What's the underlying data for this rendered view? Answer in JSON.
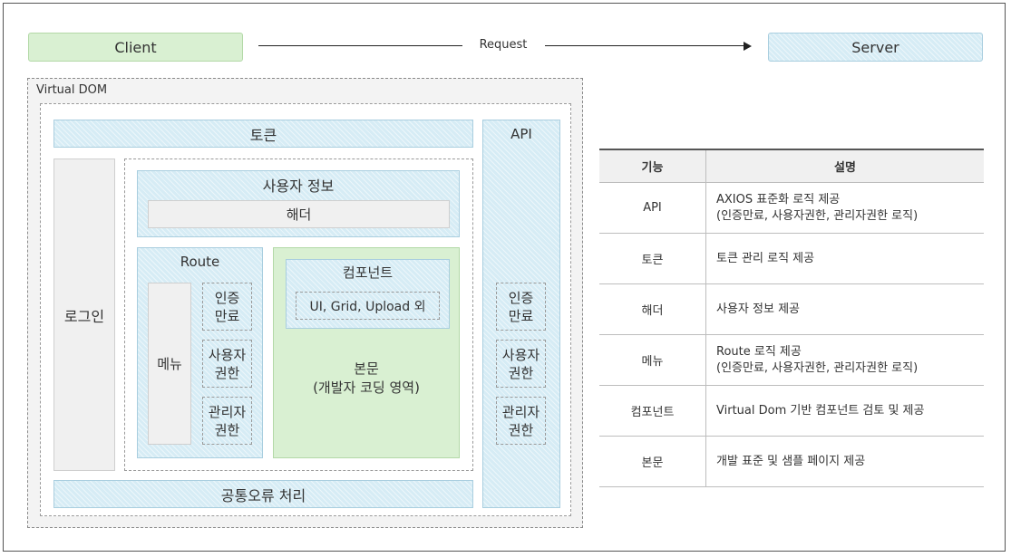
{
  "top": {
    "client": "Client",
    "request": "Request",
    "server": "Server"
  },
  "vdom": {
    "title": "Virtual DOM",
    "token": "토큰",
    "login": "로그인",
    "api": {
      "title": "API",
      "items": [
        {
          "line1": "인증",
          "line2": "만료"
        },
        {
          "line1": "사용자",
          "line2": "권한"
        },
        {
          "line1": "관리자",
          "line2": "권한"
        }
      ]
    },
    "user_info": "사용자 정보",
    "header": "해더",
    "route": {
      "title": "Route",
      "menu": "메뉴",
      "items": [
        {
          "line1": "인증",
          "line2": "만료"
        },
        {
          "line1": "사용자",
          "line2": "권한"
        },
        {
          "line1": "관리자",
          "line2": "권한"
        }
      ]
    },
    "body": {
      "component": "컴포넌트",
      "component_detail": "UI, Grid, Upload 외",
      "line1": "본문",
      "line2": "(개발자 코딩 영역)"
    },
    "common_error": "공통오류 처리"
  },
  "table": {
    "headers": [
      "기능",
      "설명"
    ],
    "rows": [
      {
        "name": "API",
        "desc1": "AXIOS 표준화 로직 제공",
        "desc2": "(인증만료, 사용자권한, 관리자권한 로직)"
      },
      {
        "name": "토큰",
        "desc1": "토큰 관리 로직 제공",
        "desc2": ""
      },
      {
        "name": "해더",
        "desc1": "사용자 정보 제공",
        "desc2": ""
      },
      {
        "name": "메뉴",
        "desc1": "Route 로직 제공",
        "desc2": "(인증만료, 사용자권한, 관리자권한 로직)"
      },
      {
        "name": "컴포넌트",
        "desc1": "Virtual Dom 기반 컴포넌트 검토 및 제공",
        "desc2": ""
      },
      {
        "name": "본문",
        "desc1": "개발 표준 및 샘플 페이지 제공",
        "desc2": ""
      }
    ]
  }
}
